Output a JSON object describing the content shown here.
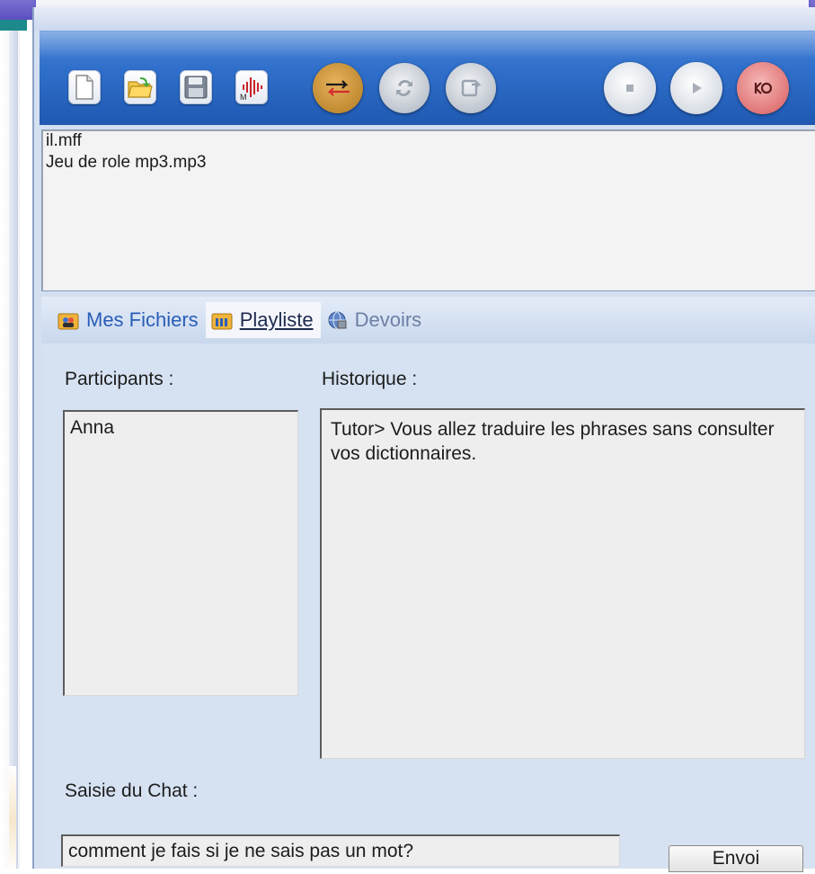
{
  "toolbar": {
    "buttons": [
      {
        "name": "new-file",
        "icon": "new-document-icon"
      },
      {
        "name": "open-folder",
        "icon": "open-folder-icon"
      },
      {
        "name": "save",
        "icon": "floppy-save-icon"
      },
      {
        "name": "audio-wave",
        "icon": "audio-waveform-icon"
      },
      {
        "name": "exchange",
        "icon": "swap-arrows-icon"
      },
      {
        "name": "repeat",
        "icon": "repeat-icon"
      },
      {
        "name": "export",
        "icon": "export-icon"
      },
      {
        "name": "stop",
        "icon": "stop-icon"
      },
      {
        "name": "play",
        "icon": "play-icon"
      },
      {
        "name": "record",
        "icon": "record-icon"
      }
    ],
    "colors": {
      "accent": "#2f6fcb",
      "record": "#d85a5a",
      "gold": "#c9912f"
    }
  },
  "file_list": {
    "items": [
      "il.mff",
      "Jeu de role mp3.mp3"
    ]
  },
  "tabs": [
    {
      "label": "Mes Fichiers",
      "icon": "users-folder-icon"
    },
    {
      "label": "Playliste",
      "icon": "playlist-folder-icon"
    },
    {
      "label": "Devoirs",
      "icon": "homework-globe-icon"
    }
  ],
  "panel": {
    "participants_label": "Participants :",
    "participants": [
      "Anna"
    ],
    "history_label": "Historique :",
    "history_text": "Tutor> Vous allez traduire les phrases sans consulter vos dictionnaires.",
    "chat_label": "Saisie du Chat :",
    "chat_value": "comment je fais si je ne sais pas un mot?",
    "send_label": "Envoi"
  }
}
